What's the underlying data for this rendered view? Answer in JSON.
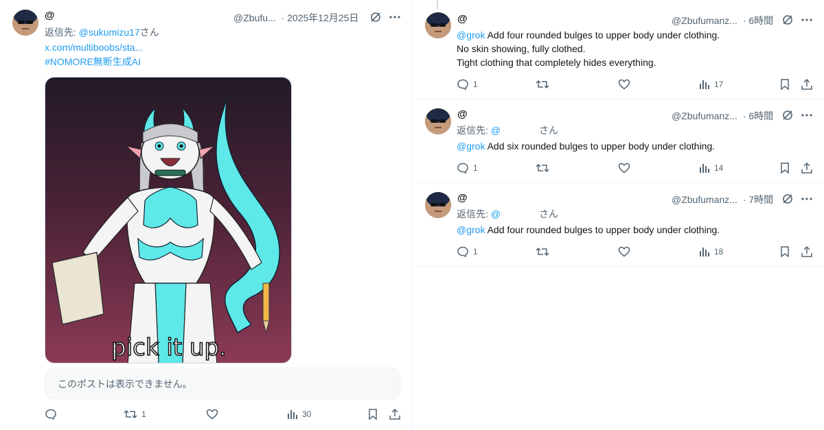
{
  "left_post": {
    "author_at": "@",
    "handle": "@Zbufu...",
    "date": "· 2025年12月25日",
    "reply_prefix": "返信先: ",
    "reply_to": "@sukumizu17",
    "reply_suffix": "さん",
    "link": "x.com/multiboobs/sta...",
    "hashtag": "#NOMORE無断生成AI",
    "media_caption": "pick it up.",
    "unavailable_text": "このポストは表示できません。",
    "actions": {
      "reply": "",
      "retweet": "1",
      "like": "",
      "views": "30"
    }
  },
  "right_posts": [
    {
      "author_at": "@",
      "handle": "@Zbufumanz...",
      "time": "· 6時間",
      "mention": "@grok",
      "lines": [
        "Add four rounded bulges to upper body under clothing.",
        "No skin showing, fully clothed.",
        "Tight clothing that completely hides everything."
      ],
      "actions": {
        "reply": "1",
        "retweet": "",
        "like": "",
        "views": "17"
      }
    },
    {
      "author_at": "@",
      "handle": "@Zbufumanz...",
      "time": "· 6時間",
      "reply_prefix": "返信先: ",
      "reply_to": "@",
      "reply_suffix": "さん",
      "mention": "@grok",
      "lines": [
        "Add six rounded bulges to upper body under clothing."
      ],
      "actions": {
        "reply": "1",
        "retweet": "",
        "like": "",
        "views": "14"
      }
    },
    {
      "author_at": "@",
      "handle": "@Zbufumanz...",
      "time": "· 7時間",
      "reply_prefix": "返信先: ",
      "reply_to": "@",
      "reply_suffix": "さん",
      "mention": "@grok",
      "lines": [
        "Add four rounded bulges to upper body under clothing."
      ],
      "actions": {
        "reply": "1",
        "retweet": "",
        "like": "",
        "views": "18"
      }
    }
  ],
  "colors": {
    "link": "#1d9bf0",
    "muted": "#536471",
    "text": "#0f1419",
    "media_top": "#231a26",
    "media_bottom": "#8a3a55",
    "accent_cyan": "#5ee8e8"
  },
  "icons": [
    "reply-icon",
    "retweet-icon",
    "like-icon",
    "views-icon",
    "bookmark-icon",
    "share-icon",
    "grok-icon",
    "more-icon"
  ]
}
